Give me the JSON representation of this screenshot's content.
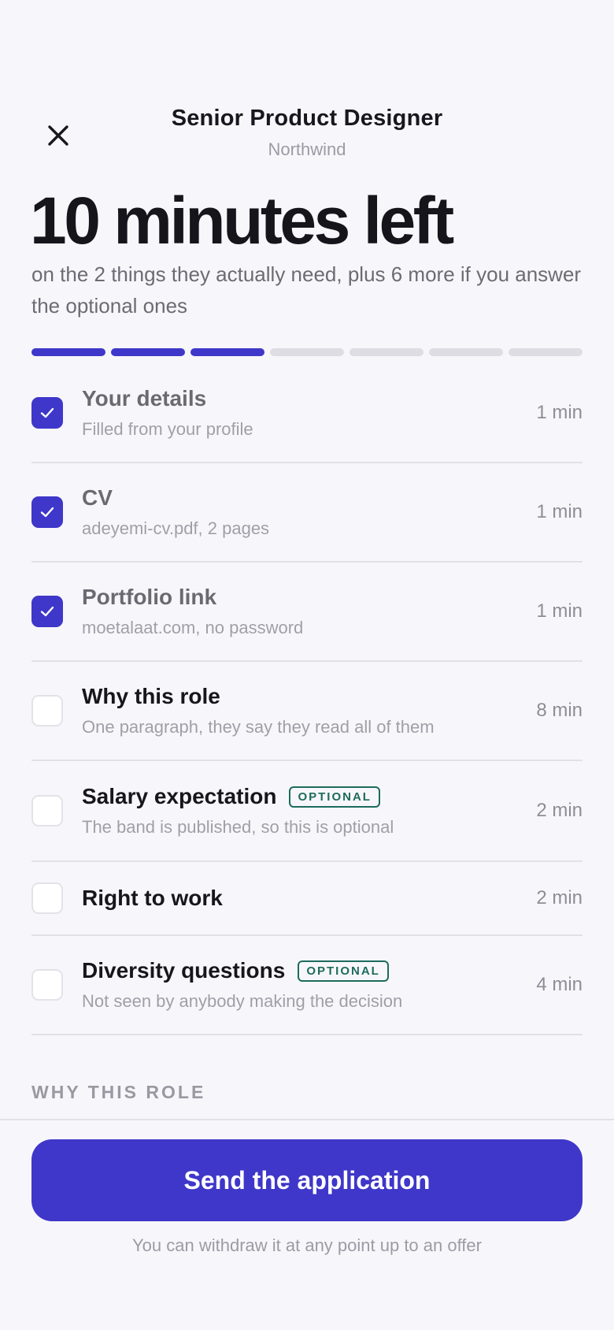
{
  "header": {
    "title": "Senior Product Designer",
    "company": "Northwind",
    "close_icon": "close-icon"
  },
  "hero": {
    "headline": "10 minutes left",
    "subline": "on the 2 things they actually need, plus 6 more if you answer the optional ones"
  },
  "progress": {
    "total_segments": 7,
    "completed_segments": 3
  },
  "steps": [
    {
      "title": "Your details",
      "desc": "Filled from your profile",
      "time": "1 min",
      "checked": true,
      "optional": false
    },
    {
      "title": "CV",
      "desc": "adeyemi-cv.pdf, 2 pages",
      "time": "1 min",
      "checked": true,
      "optional": false
    },
    {
      "title": "Portfolio link",
      "desc": "moetalaat.com, no password",
      "time": "1 min",
      "checked": true,
      "optional": false
    },
    {
      "title": "Why this role",
      "desc": "One paragraph, they say they read all of them",
      "time": "8 min",
      "checked": false,
      "optional": false
    },
    {
      "title": "Salary expectation",
      "desc": "The band is published, so this is optional",
      "time": "2 min",
      "checked": false,
      "optional": true,
      "badge": "OPTIONAL"
    },
    {
      "title": "Right to work",
      "desc": "",
      "time": "2 min",
      "checked": false,
      "optional": false
    },
    {
      "title": "Diversity questions",
      "desc": "Not seen by anybody making the decision",
      "time": "4 min",
      "checked": false,
      "optional": true,
      "badge": "OPTIONAL"
    }
  ],
  "section_label": "WHY THIS ROLE",
  "footer": {
    "send_label": "Send the application",
    "note": "You can withdraw it at any point up to an offer"
  },
  "colors": {
    "accent": "#3f37c9",
    "optional_badge": "#1d6b5c",
    "background": "#f7f7fb"
  }
}
